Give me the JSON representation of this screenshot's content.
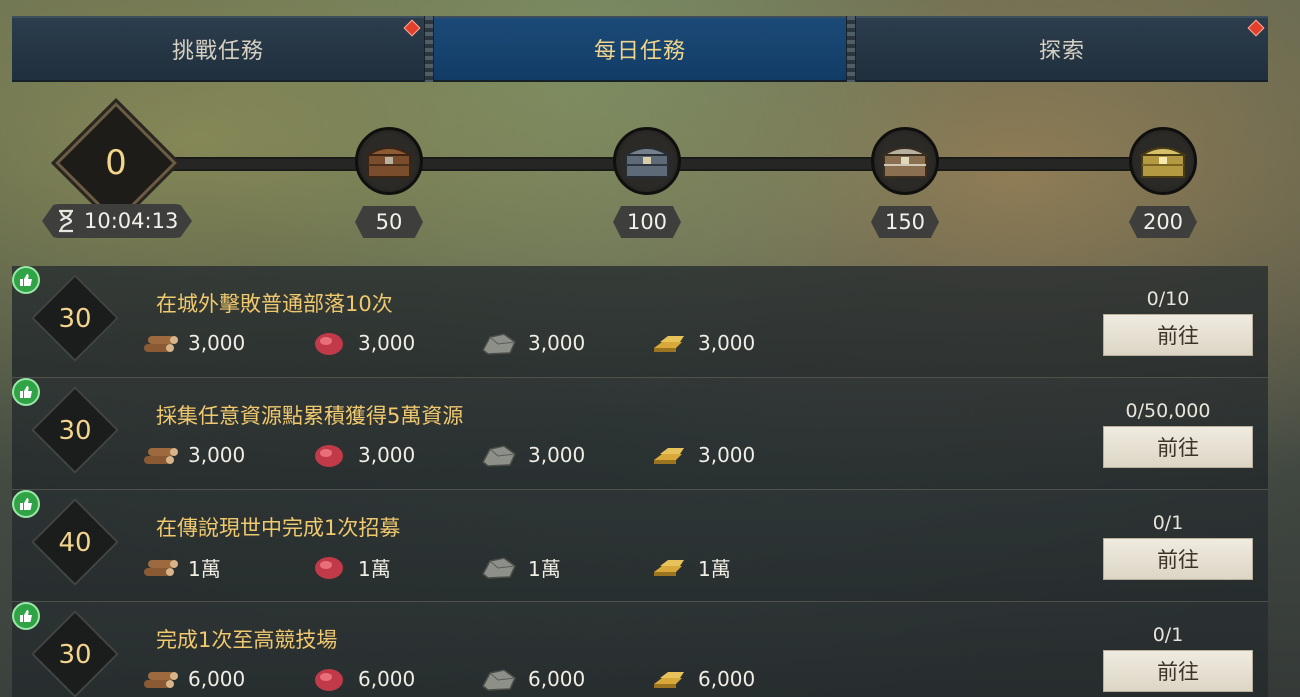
{
  "tabs": [
    {
      "label": "挑戰任務",
      "active": false,
      "has_alert": true
    },
    {
      "label": "每日任務",
      "active": true,
      "has_alert": false
    },
    {
      "label": "探索",
      "active": false,
      "has_alert": true
    }
  ],
  "activity": {
    "current_points": "0",
    "timer": "10:04:13",
    "milestones": [
      {
        "threshold": "50",
        "icon": "wooden-chest-icon"
      },
      {
        "threshold": "100",
        "icon": "iron-chest-icon"
      },
      {
        "threshold": "150",
        "icon": "silver-chest-icon"
      },
      {
        "threshold": "200",
        "icon": "gold-chest-icon"
      }
    ]
  },
  "tasks": [
    {
      "points": "30",
      "title": "在城外擊敗普通部落10次",
      "progress": "0/10",
      "button": "前往",
      "rewards": [
        {
          "icon": "wood-icon",
          "amount": "3,000"
        },
        {
          "icon": "meat-icon",
          "amount": "3,000"
        },
        {
          "icon": "stone-icon",
          "amount": "3,000"
        },
        {
          "icon": "gold-bar-icon",
          "amount": "3,000"
        }
      ]
    },
    {
      "points": "30",
      "title": "採集任意資源點累積獲得5萬資源",
      "progress": "0/50,000",
      "button": "前往",
      "rewards": [
        {
          "icon": "wood-icon",
          "amount": "3,000"
        },
        {
          "icon": "meat-icon",
          "amount": "3,000"
        },
        {
          "icon": "stone-icon",
          "amount": "3,000"
        },
        {
          "icon": "gold-bar-icon",
          "amount": "3,000"
        }
      ]
    },
    {
      "points": "40",
      "title": "在傳說現世中完成1次招募",
      "progress": "0/1",
      "button": "前往",
      "rewards": [
        {
          "icon": "wood-icon",
          "amount": "1萬"
        },
        {
          "icon": "meat-icon",
          "amount": "1萬"
        },
        {
          "icon": "stone-icon",
          "amount": "1萬"
        },
        {
          "icon": "gold-bar-icon",
          "amount": "1萬"
        }
      ]
    },
    {
      "points": "30",
      "title": "完成1次至高競技場",
      "progress": "0/1",
      "button": "前往",
      "rewards": [
        {
          "icon": "wood-icon",
          "amount": "6,000"
        },
        {
          "icon": "meat-icon",
          "amount": "6,000"
        },
        {
          "icon": "stone-icon",
          "amount": "6,000"
        },
        {
          "icon": "gold-bar-icon",
          "amount": "6,000"
        }
      ]
    }
  ],
  "colors": {
    "tab_active": "#123c66",
    "points_gold": "#f2d48b",
    "title_gold": "#f0c86e",
    "like_green": "#2fa345"
  }
}
